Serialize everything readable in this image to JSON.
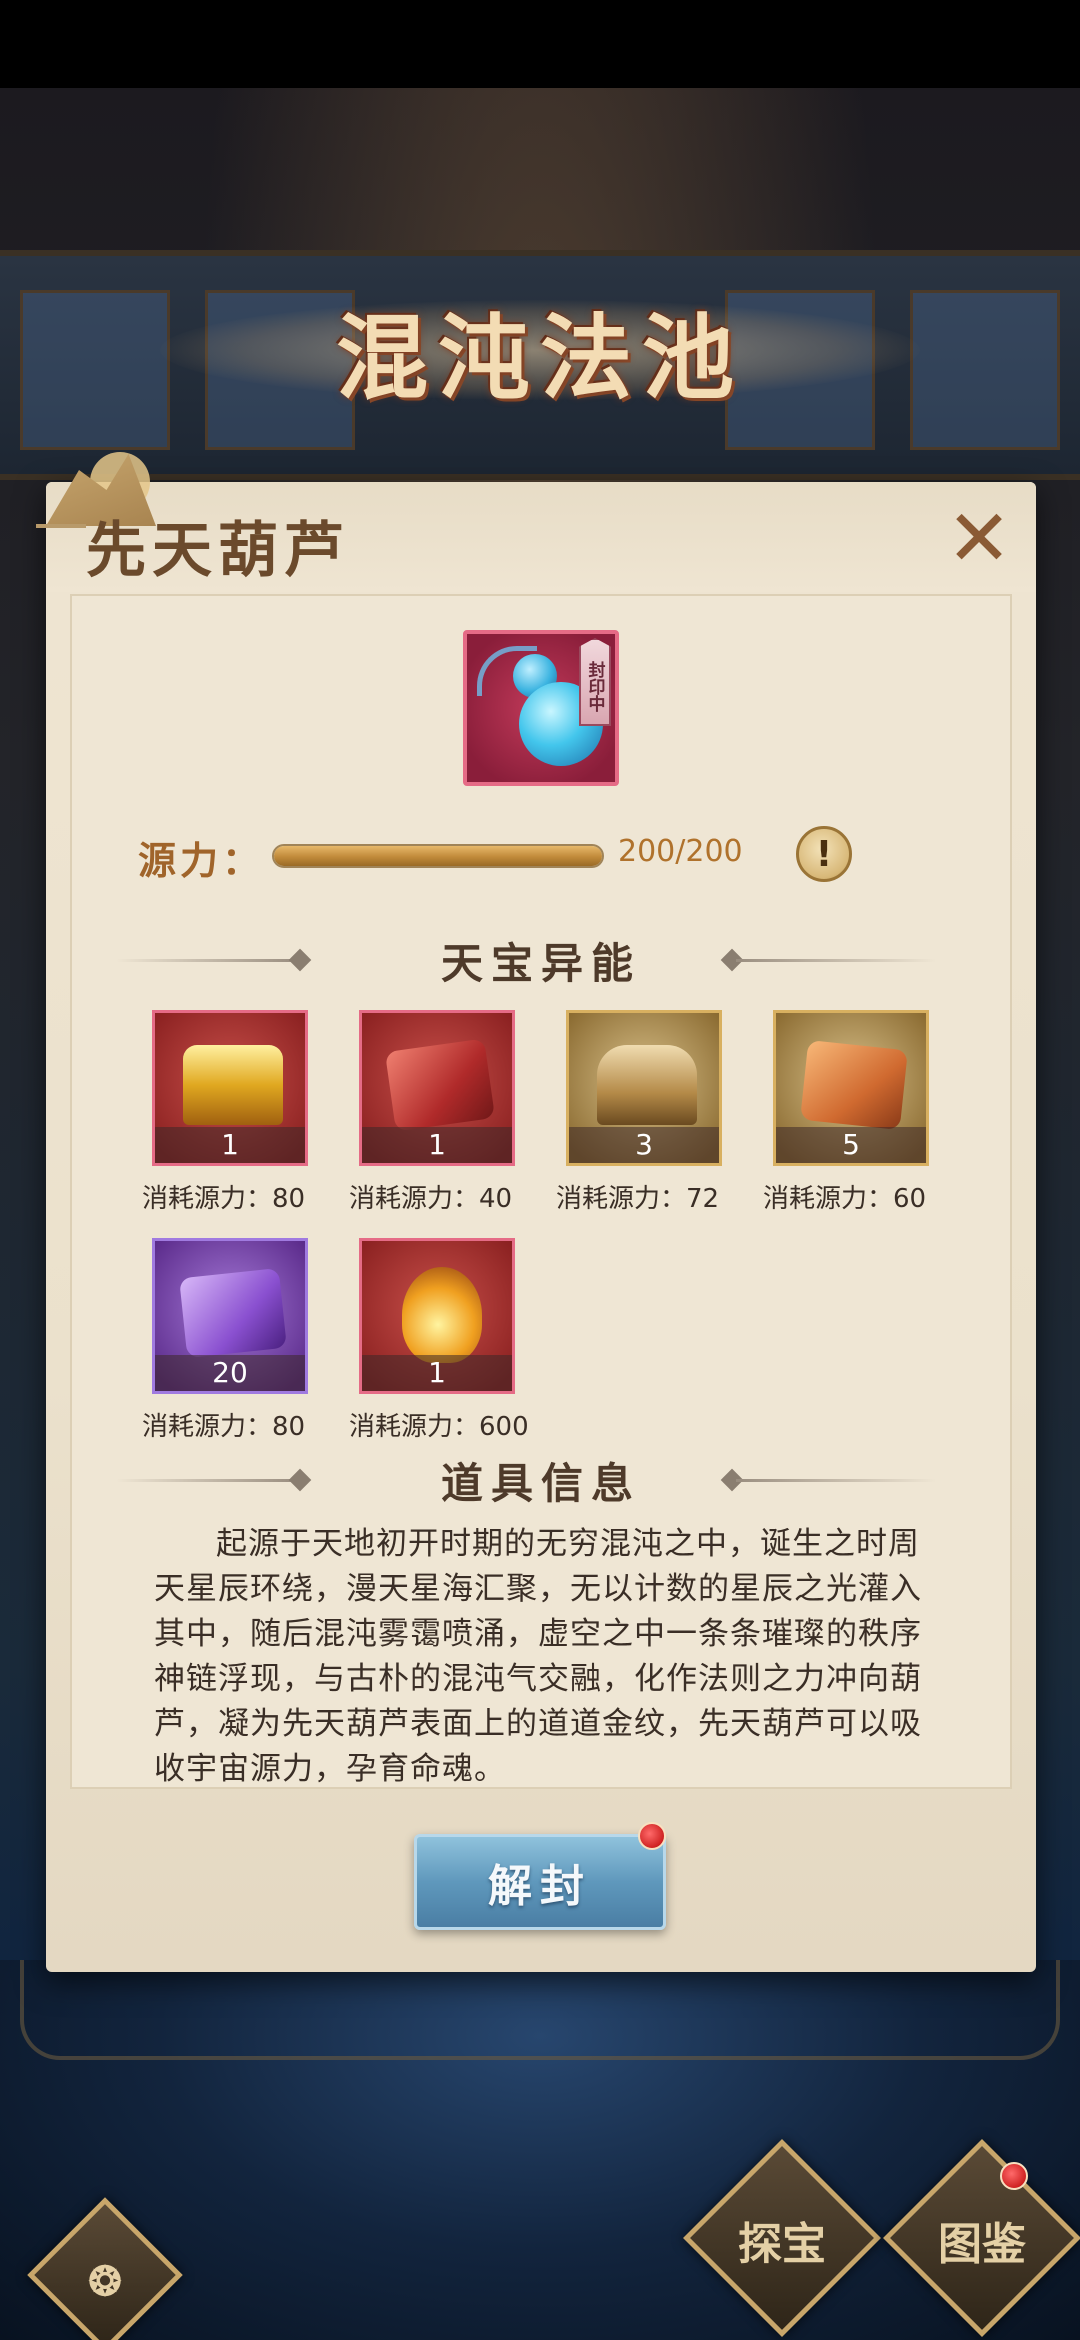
{
  "banner": {
    "title": "混沌法池"
  },
  "panel": {
    "title": "先天葫芦",
    "close_icon": "close-icon"
  },
  "item": {
    "icon": "gourd-icon",
    "seal_status": "封印中"
  },
  "energy": {
    "label": "源力：",
    "value_text": "200/200",
    "fraction": 1.0,
    "info_symbol": "!"
  },
  "abilities_section": {
    "title": "天宝异能",
    "items": [
      {
        "icon": "golden-chest-icon",
        "count": "1",
        "cost": "消耗源力：80"
      },
      {
        "icon": "red-giftbox-icon",
        "count": "1",
        "cost": "消耗源力：40"
      },
      {
        "icon": "bronze-chest-icon",
        "count": "3",
        "cost": "消耗源力：72"
      },
      {
        "icon": "orange-giftbox-icon",
        "count": "5",
        "cost": "消耗源力：60"
      },
      {
        "icon": "purple-giftbox-icon",
        "count": "20",
        "cost": "消耗源力：80"
      },
      {
        "icon": "elixir-bottle-icon",
        "count": "1",
        "cost": "消耗源力：600"
      }
    ]
  },
  "info_section": {
    "title": "道具信息",
    "description": "起源于天地初开时期的无穷混沌之中，诞生之时周天星辰环绕，漫天星海汇聚，无以计数的星辰之光灌入其中，随后混沌雾霭喷涌，虚空之中一条条璀璨的秩序神链浮现，与古朴的混沌气交融，化作法则之力冲向葫芦，凝为先天葫芦表面上的道道金纹，先天葫芦可以吸收宇宙源力，孕育命魂。"
  },
  "actions": {
    "unseal_label": "解封"
  },
  "bottom_nav": {
    "left_icon": "swirl-emblem-icon",
    "explore_label": "探宝",
    "catalog_label": "图鉴"
  },
  "colors": {
    "accent_pink": "#e56b86",
    "button_blue": "#5f98bc",
    "gold_text": "#a0642a"
  }
}
